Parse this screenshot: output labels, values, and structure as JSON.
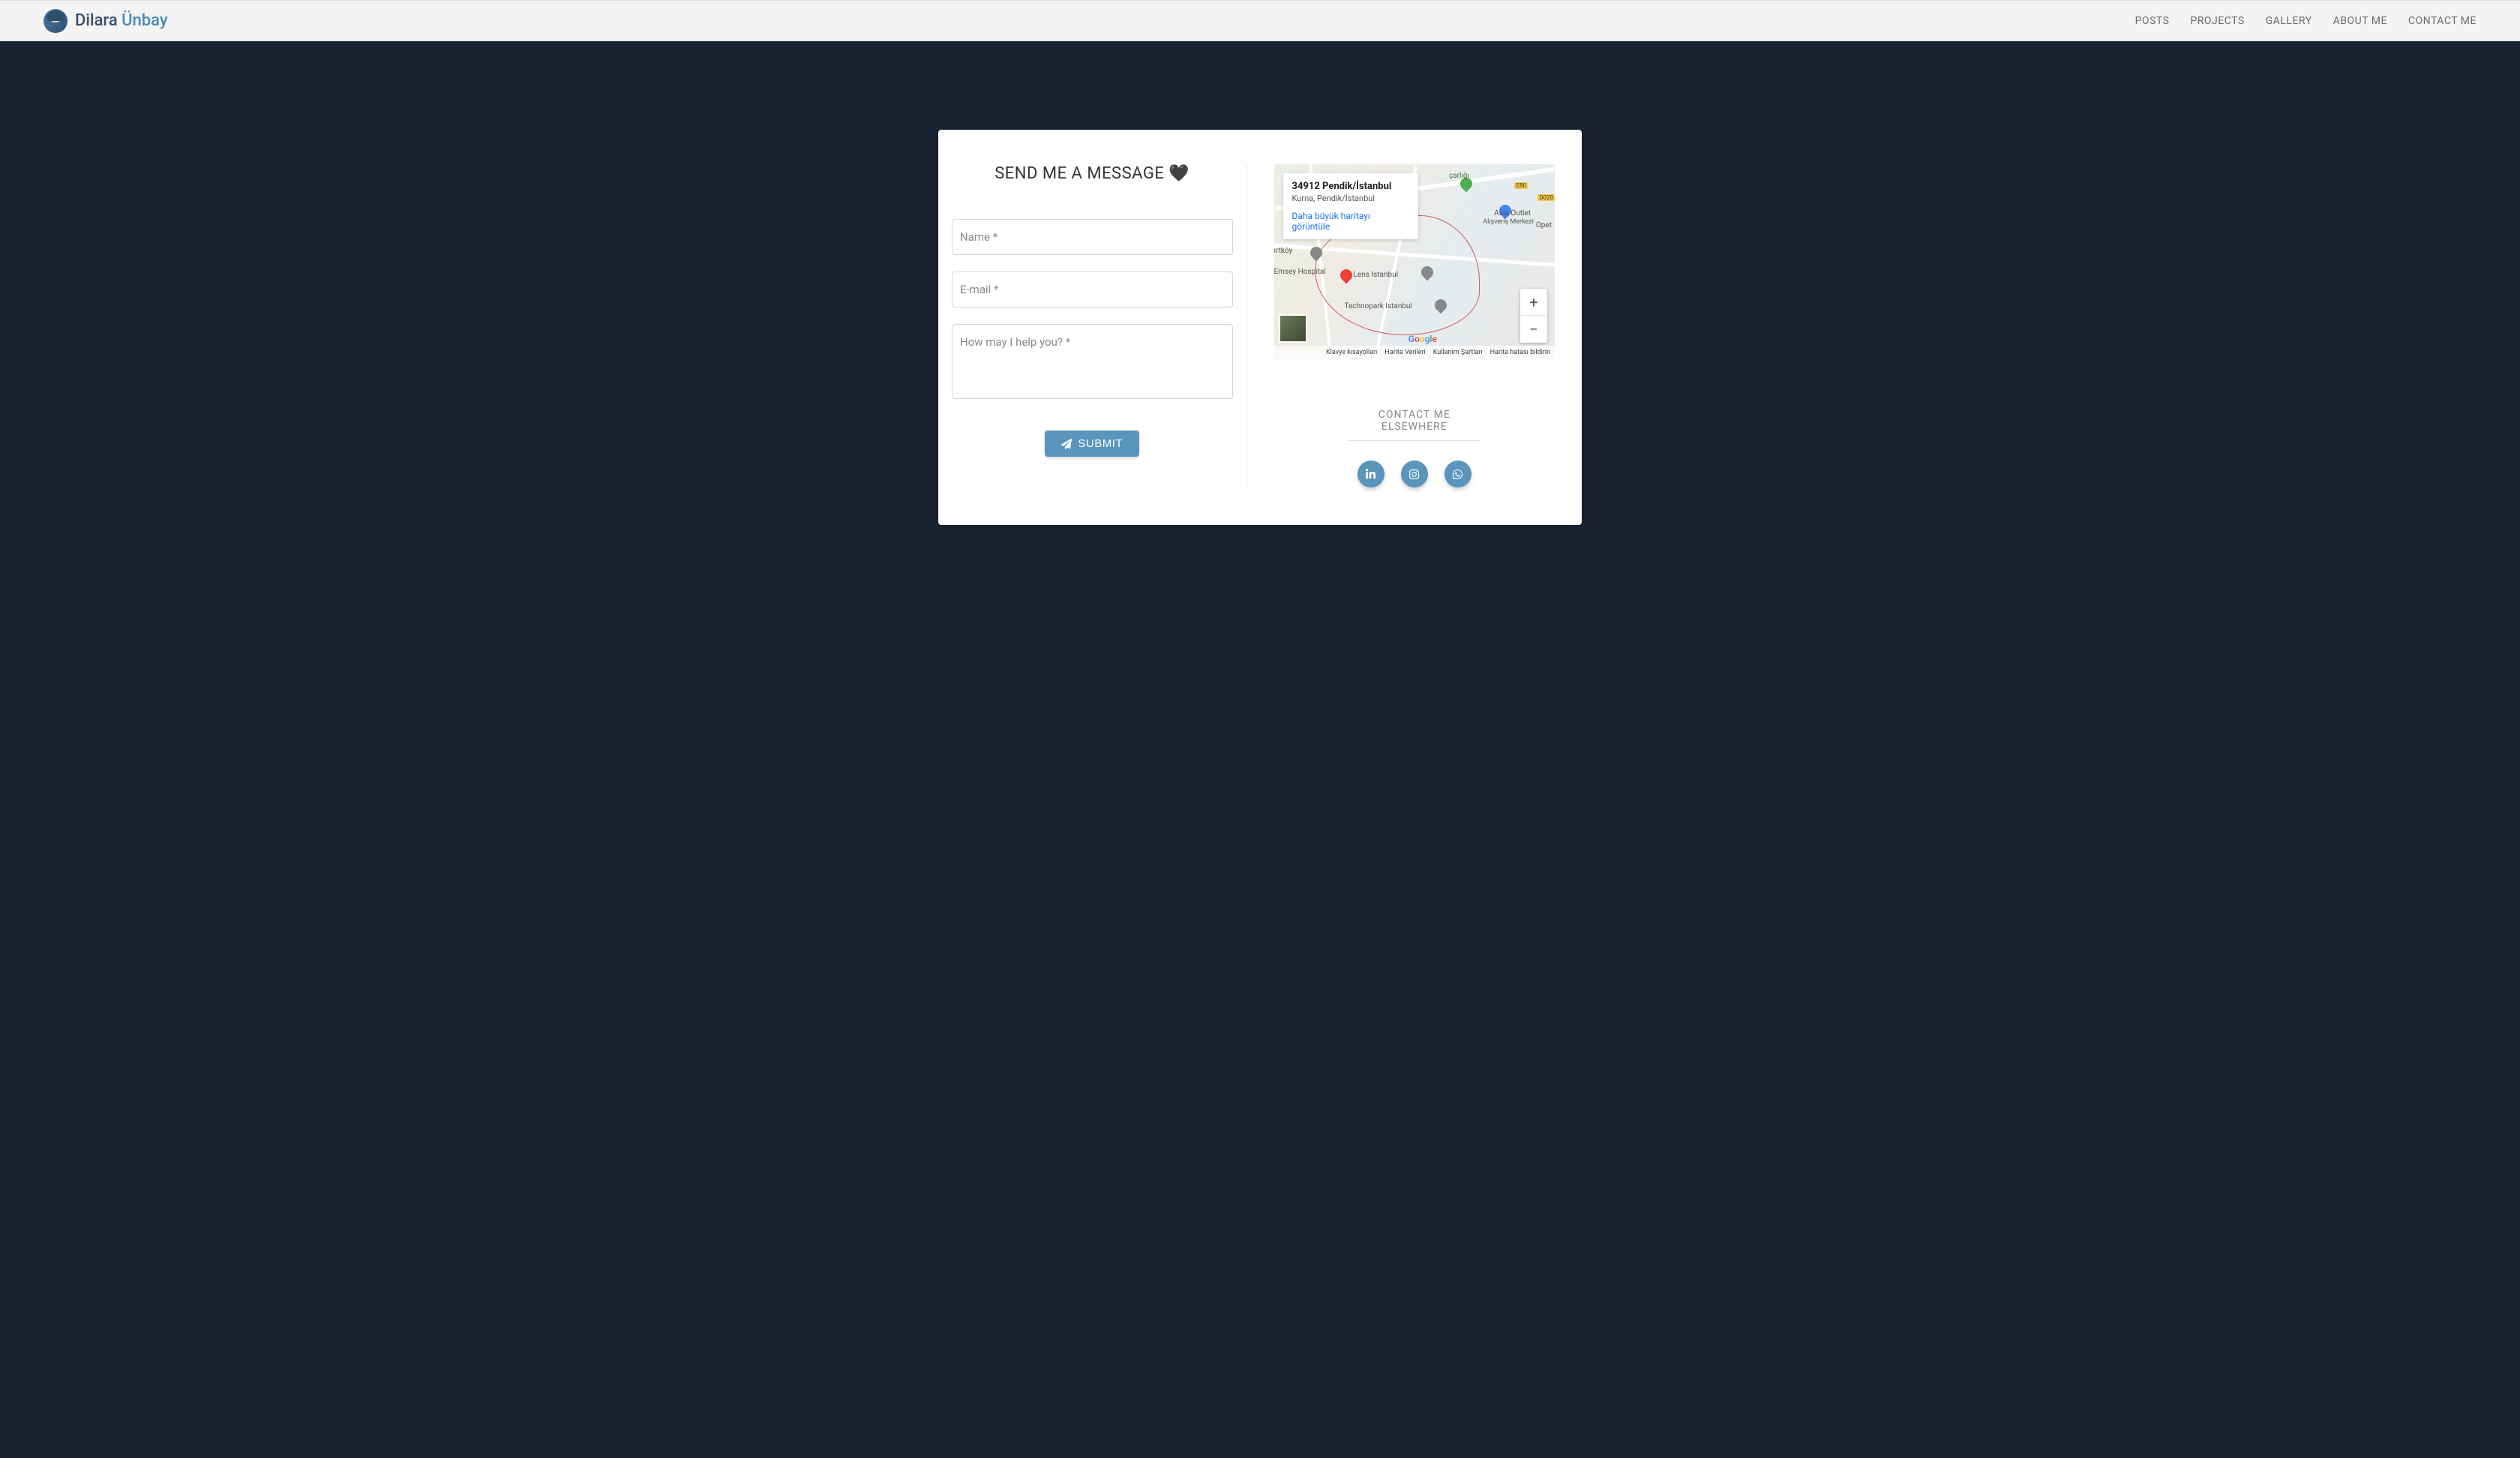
{
  "brand": {
    "first": "Dilara ",
    "last": "Ünbay"
  },
  "nav": {
    "posts": "POSTS",
    "projects": "PROJECTS",
    "gallery": "GALLERY",
    "about": "ABOUT ME",
    "contact": "CONTACT ME"
  },
  "form": {
    "title": "SEND ME A MESSAGE 🖤",
    "name_placeholder": "Name *",
    "email_placeholder": "E-mail *",
    "message_placeholder": "How may I help you? *",
    "submit": "SUBMIT"
  },
  "map": {
    "info_title": "34912 Pendik/İstanbul",
    "info_sub": "Kurna, Pendik/İstanbul",
    "info_link": "Daha büyük haritayı görüntüle",
    "labels": {
      "lens": "Lens Istanbul",
      "technopark": "Technopark Istanbul",
      "irtkoy": "ırtköy",
      "emsey": "Emsey Hospital",
      "asia1": "Asia Outlet",
      "asia2": "Alışveriş Merkezi",
      "opet": "Opet",
      "e80": "E80",
      "d020": "D020",
      "carligi": "çarlığı"
    },
    "footer": {
      "shortcuts": "Klavye kısayolları",
      "mapdata": "Harita Verileri",
      "terms": "Kullanım Şartları",
      "report": "Harita hatası bildirin"
    }
  },
  "elsewhere": {
    "title": "CONTACT ME ELSEWHERE"
  },
  "socials": {
    "linkedin": "linkedin-icon",
    "instagram": "instagram-icon",
    "whatsapp": "whatsapp-icon"
  }
}
